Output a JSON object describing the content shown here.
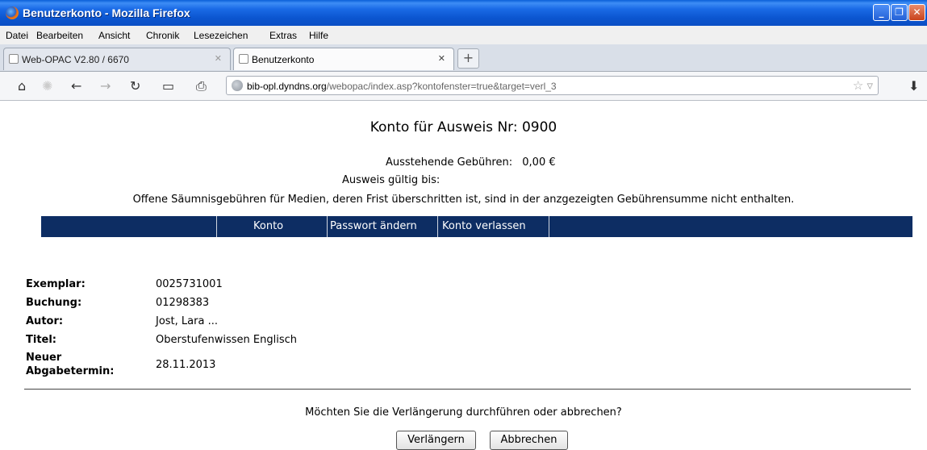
{
  "window": {
    "title": "Benutzerkonto - Mozilla Firefox"
  },
  "menu": [
    "Datei",
    "Bearbeiten",
    "Ansicht",
    "Chronik",
    "Lesezeichen",
    "Extras",
    "Hilfe"
  ],
  "tabs": [
    {
      "label": "Web-OPAC V2.80 / 6670"
    },
    {
      "label": "Benutzerkonto"
    }
  ],
  "address": {
    "host": "bib-opl.dyndns.org",
    "path": "/webopac/index.asp?kontofenster=true&target=verl_3"
  },
  "page": {
    "heading": "Konto für Ausweis Nr:  0900",
    "fees_label": "Ausstehende Gebühren:",
    "fees_value": "0,00 €",
    "valid_label": "Ausweis gültig bis:",
    "notice": "Offene Säumnisgebühren für Medien, deren Frist überschritten ist, sind in der anzgezeigten Gebührensumme nicht enthalten.",
    "nav": [
      "Konto",
      "Passwort ändern",
      "Konto verlassen"
    ],
    "details": [
      {
        "label": "Exemplar:",
        "value": "0025731001"
      },
      {
        "label": "Buchung:",
        "value": "01298383"
      },
      {
        "label": "Autor:",
        "value": "Jost, Lara ..."
      },
      {
        "label": "Titel:",
        "value": "Oberstufenwissen Englisch"
      },
      {
        "label": "Neuer",
        "label2": "Abgabetermin:",
        "value": "28.11.2013"
      }
    ],
    "question": "Möchten Sie die Verlängerung durchführen oder abbrechen?",
    "buttons": {
      "extend": "Verlängern",
      "cancel": "Abbrechen"
    }
  }
}
